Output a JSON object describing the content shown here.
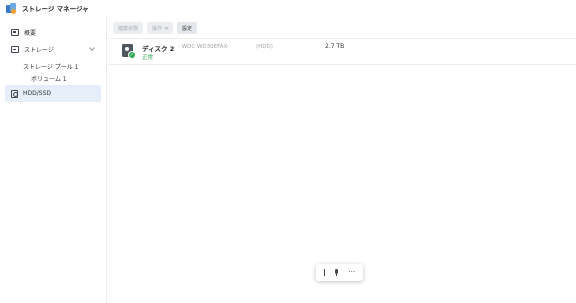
{
  "window": {
    "title": "ストレージ マネージャ",
    "icon": "storage-manager-icon"
  },
  "sidebar": {
    "items": [
      {
        "label": "概要",
        "icon": "overview-icon"
      },
      {
        "label": "ストレージ",
        "icon": "storage-icon",
        "expanded": true
      },
      {
        "label": "ストレージ プール 1"
      },
      {
        "label": "ボリューム 1"
      },
      {
        "label": "HDD/SSD",
        "icon": "disk-icon",
        "selected": true
      }
    ]
  },
  "toolbar": {
    "health_info": "健康状態",
    "actions": "操作",
    "settings": "設定"
  },
  "disks": [
    {
      "name": "ディスク 2",
      "model": "- WDC WD30EFAX-",
      "type": "(HDD)",
      "size": "2.7 TB",
      "status": "正常",
      "status_color": "#2fa84f"
    }
  ],
  "floating_toolbar": {
    "icons": [
      "text-cursor-icon",
      "microphone-icon",
      "more-icon"
    ],
    "more_label": "···"
  }
}
